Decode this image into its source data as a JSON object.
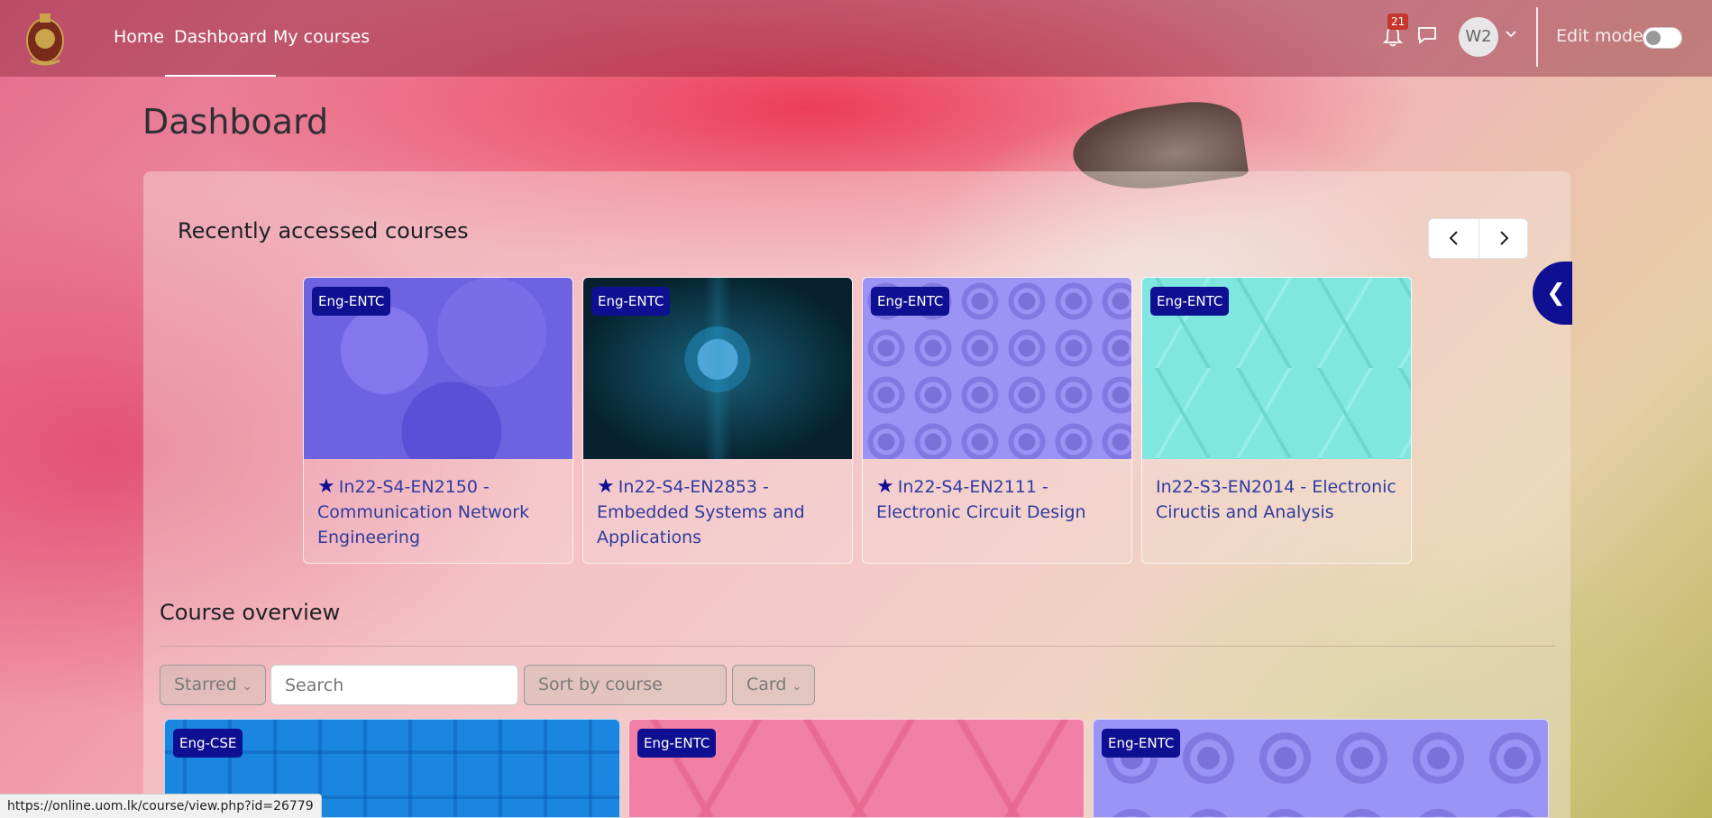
{
  "nav": {
    "links": [
      {
        "label": "Home"
      },
      {
        "label": "Dashboard"
      },
      {
        "label": "My courses"
      }
    ],
    "notification_count": "21",
    "avatar_initials": "W2",
    "edit_mode_label": "Edit mode",
    "edit_mode_on": false
  },
  "page": {
    "title": "Dashboard"
  },
  "recent": {
    "title": "Recently accessed courses",
    "courses": [
      {
        "category": "Eng-ENTC",
        "name": "In22-S4-EN2150 - Communication Network Engineering",
        "starred": true,
        "color": "#6d62e0"
      },
      {
        "category": "Eng-ENTC",
        "name": "In22-S4-EN2853 - Embedded Systems and Applications",
        "starred": true,
        "color": "#0e3f52"
      },
      {
        "category": "Eng-ENTC",
        "name": "In22-S4-EN2111 - Electronic Circuit Design",
        "starred": true,
        "color": "#9c94f5"
      },
      {
        "category": "Eng-ENTC",
        "name": "In22-S3-EN2014 - Electronic Ciructis and Analysis",
        "starred": false,
        "color": "#7fe6e0"
      }
    ]
  },
  "overview": {
    "title": "Course overview",
    "filters": {
      "grouping": "Starred",
      "search_placeholder": "Search",
      "sort": "Sort by course name",
      "view": "Card"
    },
    "courses": [
      {
        "category": "Eng-CSE",
        "color": "#1a86e0"
      },
      {
        "category": "Eng-ENTC",
        "color": "#f27fa5"
      },
      {
        "category": "Eng-ENTC",
        "color": "#9b94f7"
      }
    ]
  },
  "status_url": "https://online.uom.lk/course/view.php?id=26779",
  "colors": {
    "brand": "#0f1091",
    "link": "#2f3b9e"
  }
}
